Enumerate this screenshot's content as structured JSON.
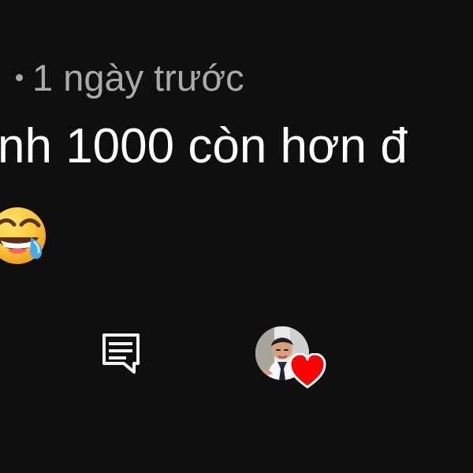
{
  "comment": {
    "timestamp": "1 ngày trước",
    "text": "nh 1000 còn hơn đ",
    "emoji": "face-with-tears-of-joy"
  },
  "actions": {
    "reply_icon": "comment-reply-icon",
    "creator_heart_icon": "red-heart-icon"
  },
  "colors": {
    "background": "#0f0f0f",
    "meta_text": "#aaaaaa",
    "comment_text": "#ffffff",
    "heart": "#ff0000",
    "emoji_yellow": "#ffc83d"
  }
}
